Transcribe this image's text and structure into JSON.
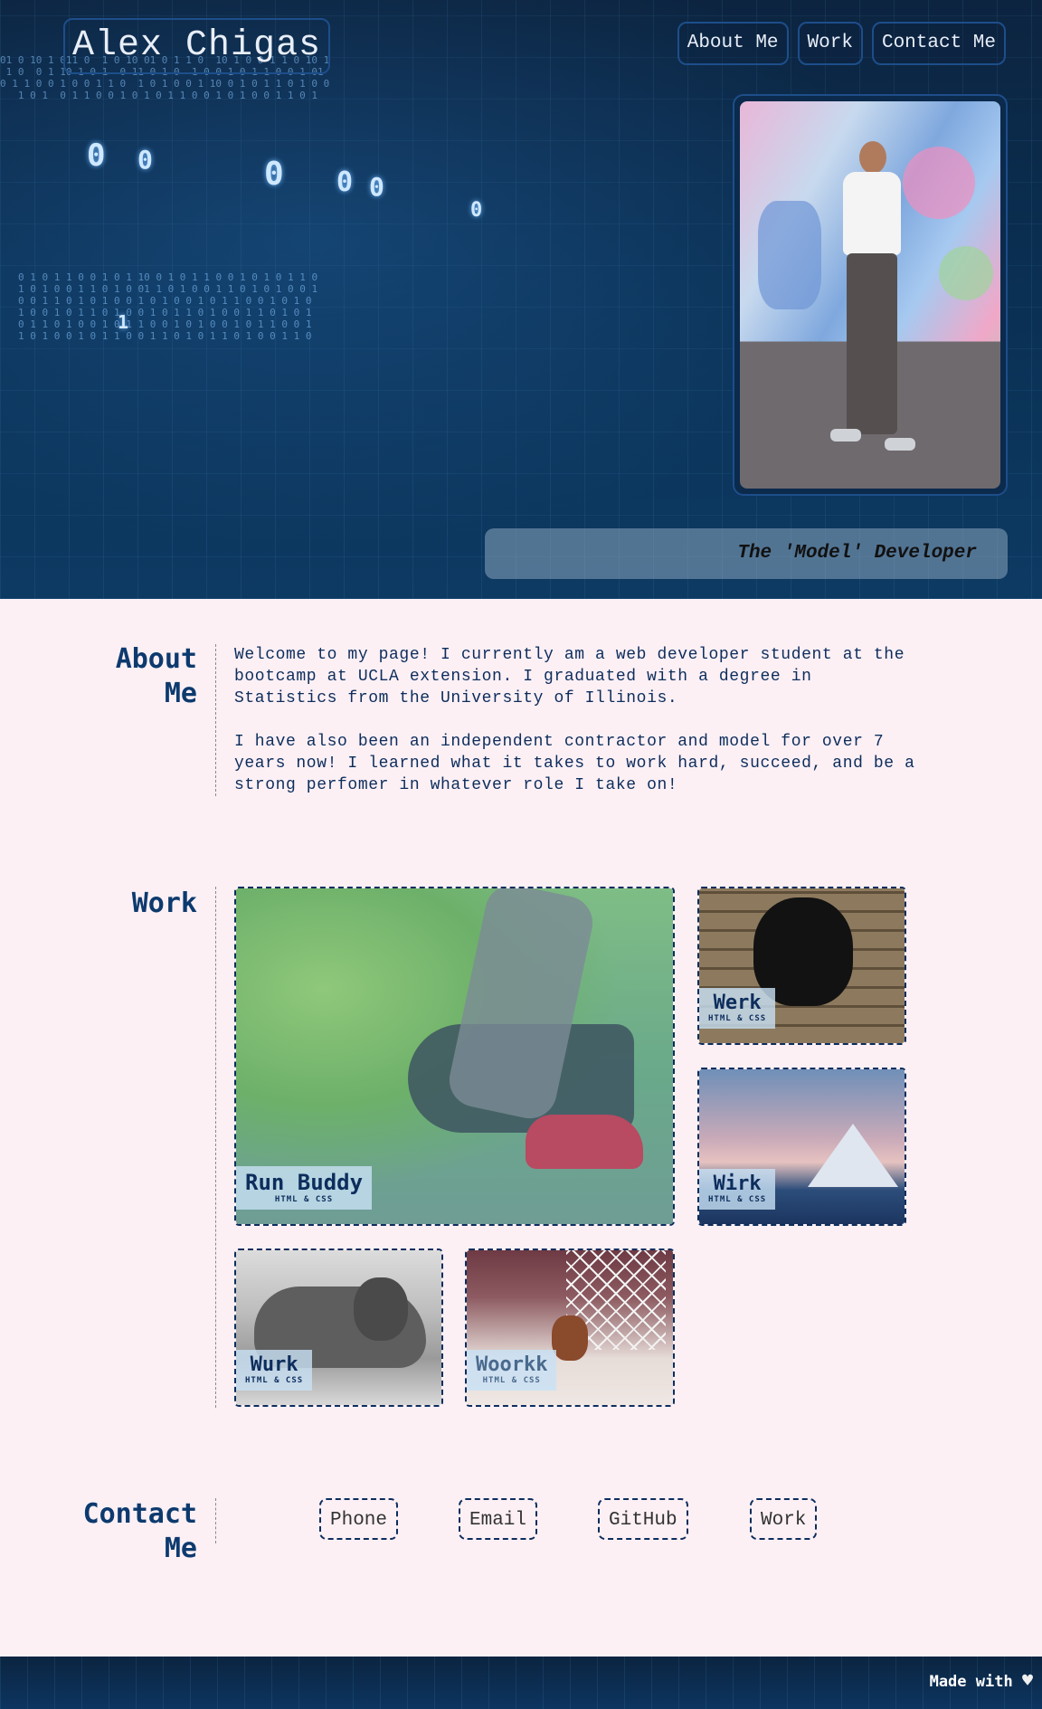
{
  "header": {
    "logo": "Alex Chigas",
    "nav": [
      "About Me",
      "Work",
      "Contact Me"
    ],
    "tagline": "The 'Model' Developer"
  },
  "about": {
    "title_line1": "About",
    "title_line2": "Me",
    "paragraphs": [
      "Welcome to my page! I currently am a web developer student at the bootcamp at UCLA extension. I graduated with a degree in Statistics from the University of Illinois.",
      "I have also been an independent contractor and model for over 7 years now! I learned what it takes to work hard, succeed, and be a strong perfomer in whatever role I take on!"
    ]
  },
  "work": {
    "title": "Work",
    "projects": [
      {
        "name": "Run Buddy",
        "tech": "HTML & CSS"
      },
      {
        "name": "Werk",
        "tech": "HTML & CSS"
      },
      {
        "name": "Wirk",
        "tech": "HTML & CSS"
      },
      {
        "name": "Wurk",
        "tech": "HTML & CSS"
      },
      {
        "name": "Woorkk",
        "tech": "HTML & CSS"
      }
    ]
  },
  "contact": {
    "title_line1": "Contact",
    "title_line2": "Me",
    "links": [
      "Phone",
      "Email",
      "GitHub",
      "Work"
    ]
  },
  "footer": {
    "text": "Made with",
    "icon": "heart-icon"
  },
  "colors": {
    "accent": "#0d3a6e",
    "background": "#fcf0f5",
    "hero": "#0a2f52"
  }
}
